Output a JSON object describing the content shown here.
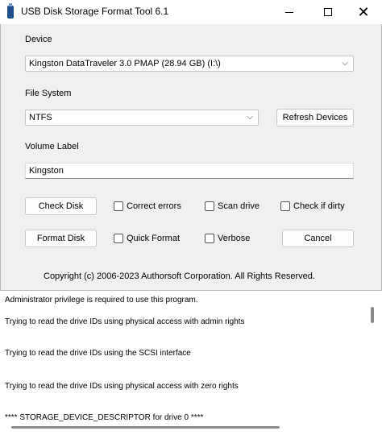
{
  "window": {
    "title": "USB Disk Storage Format Tool 6.1",
    "close_glyph": "✕"
  },
  "device": {
    "label": "Device",
    "selected": "Kingston  DataTraveler 3.0  PMAP (28.94 GB) (I:\\)"
  },
  "filesystem": {
    "label": "File System",
    "selected": "NTFS",
    "refresh_label": "Refresh Devices"
  },
  "volume": {
    "label": "Volume Label",
    "value": "Kingston"
  },
  "actions": {
    "check_disk": "Check Disk",
    "correct_errors": "Correct errors",
    "scan_drive": "Scan drive",
    "check_if_dirty": "Check if dirty",
    "format_disk": "Format Disk",
    "quick_format": "Quick Format",
    "verbose": "Verbose",
    "cancel": "Cancel"
  },
  "copyright": "Copyright (c) 2006-2023 Authorsoft Corporation. All Rights Reserved.",
  "log": {
    "lines": [
      "Administrator privilege is required to use this program.",
      "Trying to read the drive IDs using physical access with admin rights",
      "Trying to read the drive IDs using the SCSI interface",
      "Trying to read the drive IDs using physical access with zero rights",
      "**** STORAGE_DEVICE_DESCRIPTOR for drive 0 ****"
    ]
  },
  "chevron_glyph": "⌵"
}
